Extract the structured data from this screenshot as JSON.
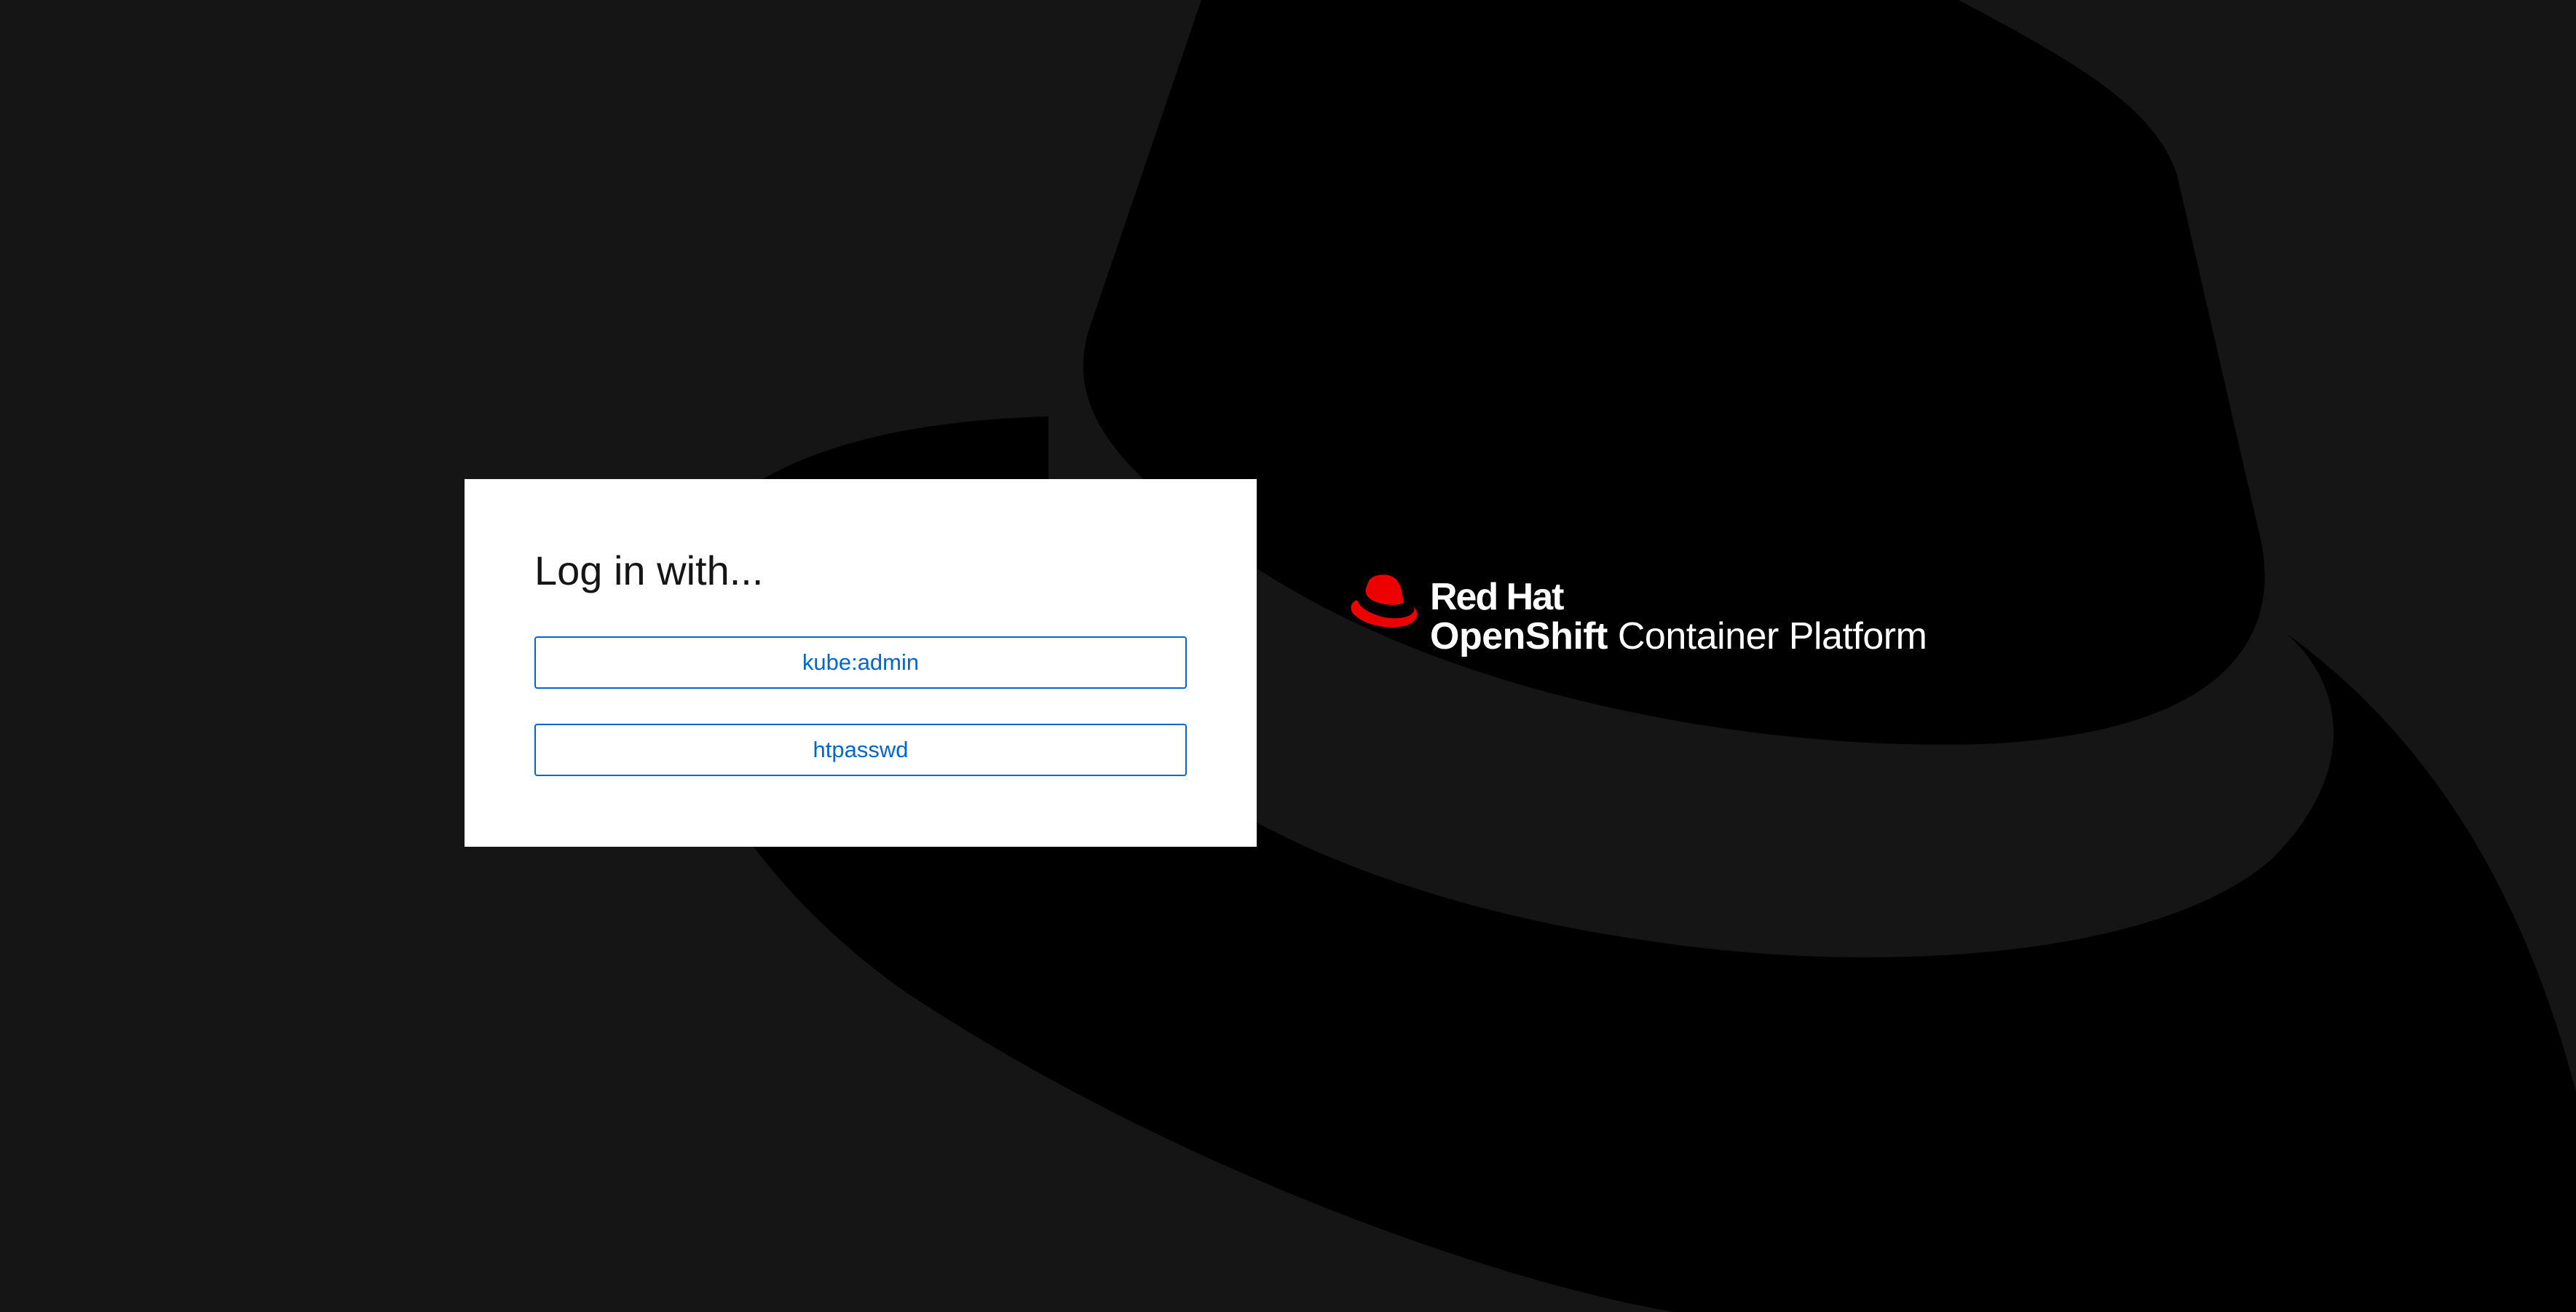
{
  "login": {
    "title": "Log in with...",
    "providers": [
      {
        "label": "kube:admin"
      },
      {
        "label": "htpasswd"
      }
    ]
  },
  "brand": {
    "company": "Red Hat",
    "product_prefix": "OpenShift",
    "product_suffix": "Container Platform",
    "logo_icon": "red-hat-fedora-icon"
  },
  "colors": {
    "page_background": "#151515",
    "background_hat": "#000000",
    "card_background": "#ffffff",
    "link_blue": "#0066cc",
    "brand_red": "#ee0000",
    "text_dark": "#151515",
    "text_light": "#ffffff"
  }
}
